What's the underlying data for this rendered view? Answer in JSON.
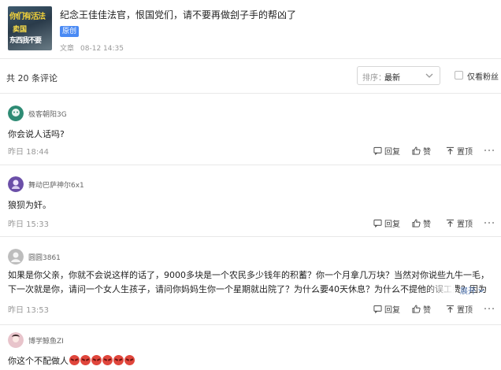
{
  "article": {
    "title": "纪念王佳佳法官，恨国党们，请不要再做刽子手的帮凶了",
    "thumbnail_lines": [
      "你们有活法",
      "卖国",
      "东西我不要"
    ],
    "badge": "原创",
    "source": "文章",
    "date": "08-12 14:35"
  },
  "toolbar": {
    "total": "共 20 条评论",
    "sort_label": "排序：",
    "sort_value": "最新",
    "fans_only_label": "仅看粉丝",
    "fans_only_checked": false
  },
  "actions": {
    "reply": "回复",
    "like": "赞",
    "pin": "置顶"
  },
  "comments": [
    {
      "username": "极客朝阳3G",
      "text": "你会说人话吗?",
      "time": "昨日 18:44",
      "avatar_color": "#2e8b74"
    },
    {
      "username": "舞动巴萨神尔6x1",
      "text": "狼狈为奸。",
      "time": "昨日 15:33",
      "avatar_color": "#7a5ab8"
    },
    {
      "username": "圆圆3861",
      "text": "如果是你父亲，你就不会说这样的话了，9000多块是一个农民多少钱年的积蓄？你一个月拿几万块？当然对你说些九牛一毛，下一次就是你，请问一个女人生孩子，请问你妈妈生你一个星期就出院了？为什么要40天休息？为什么不提他的误工费？因为你是律师",
      "expand": "展开",
      "time": "昨日 13:53",
      "avatar_color": "#9a9a9a"
    },
    {
      "username": "博学鲸鱼ZI",
      "text": "你这个不配做人",
      "emoji_count": 6,
      "time": "",
      "avatar_color": "#d9a7b0"
    }
  ],
  "colors": {
    "accent": "#4a8af4",
    "badge_text": "#ffffff",
    "muted": "#999999",
    "divider": "#e8e8e8"
  }
}
